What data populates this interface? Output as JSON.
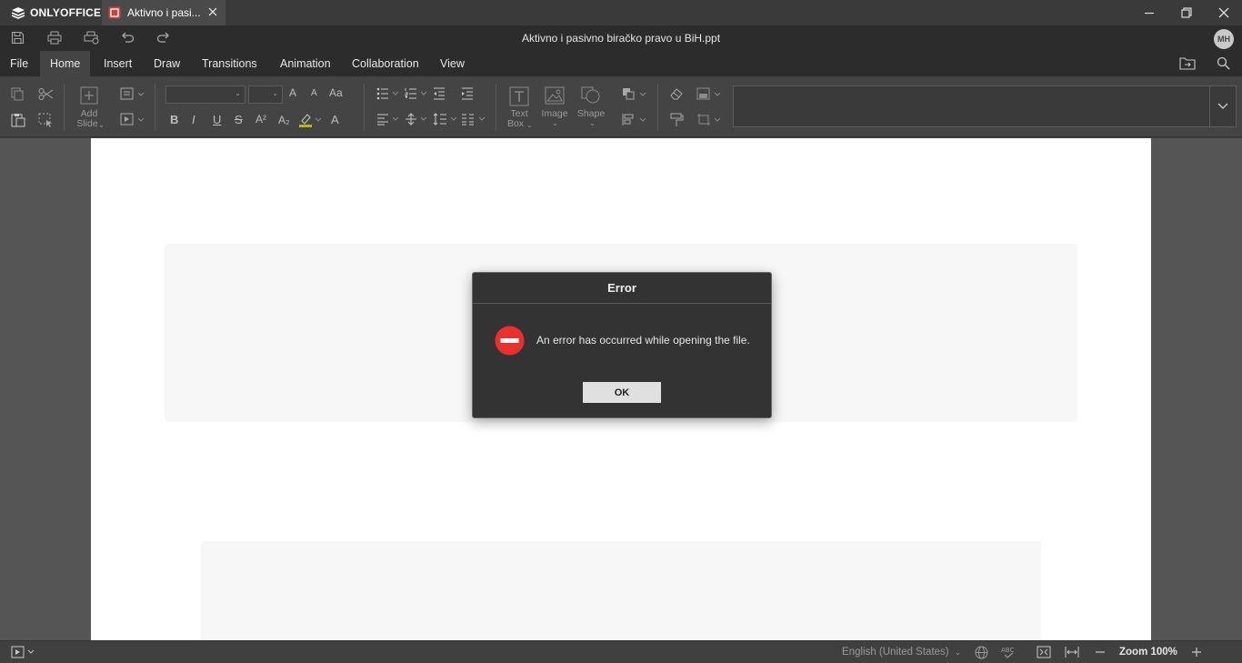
{
  "app": {
    "brand": "ONLYOFFICE"
  },
  "tab": {
    "title": "Aktivno i pasi..."
  },
  "header": {
    "doc_title": "Aktivno i pasivno biračko pravo u BiH.ppt",
    "avatar_initials": "MH"
  },
  "menu": {
    "tabs": [
      "File",
      "Home",
      "Insert",
      "Draw",
      "Transitions",
      "Animation",
      "Collaboration",
      "View"
    ],
    "active": "Home"
  },
  "toolbar": {
    "add_slide_label": "Add",
    "add_slide_label2": "Slide",
    "text_box_label": "Text",
    "text_box_label2": "Box",
    "image_label": "Image",
    "shape_label": "Shape",
    "bold": "B",
    "italic": "I",
    "underline": "U",
    "strike": "S",
    "superscript": "A²",
    "subscript": "A₂",
    "font_color": "A",
    "change_case": "Aa",
    "increase_font": "A",
    "decrease_font": "A"
  },
  "dialog": {
    "title": "Error",
    "message": "An error has occurred while opening the file.",
    "ok_label": "OK"
  },
  "status": {
    "language": "English (United States)",
    "zoom": "Zoom 100%"
  },
  "colors": {
    "error_red": "#e8312e",
    "highlight_yellow": "#b8b800"
  }
}
